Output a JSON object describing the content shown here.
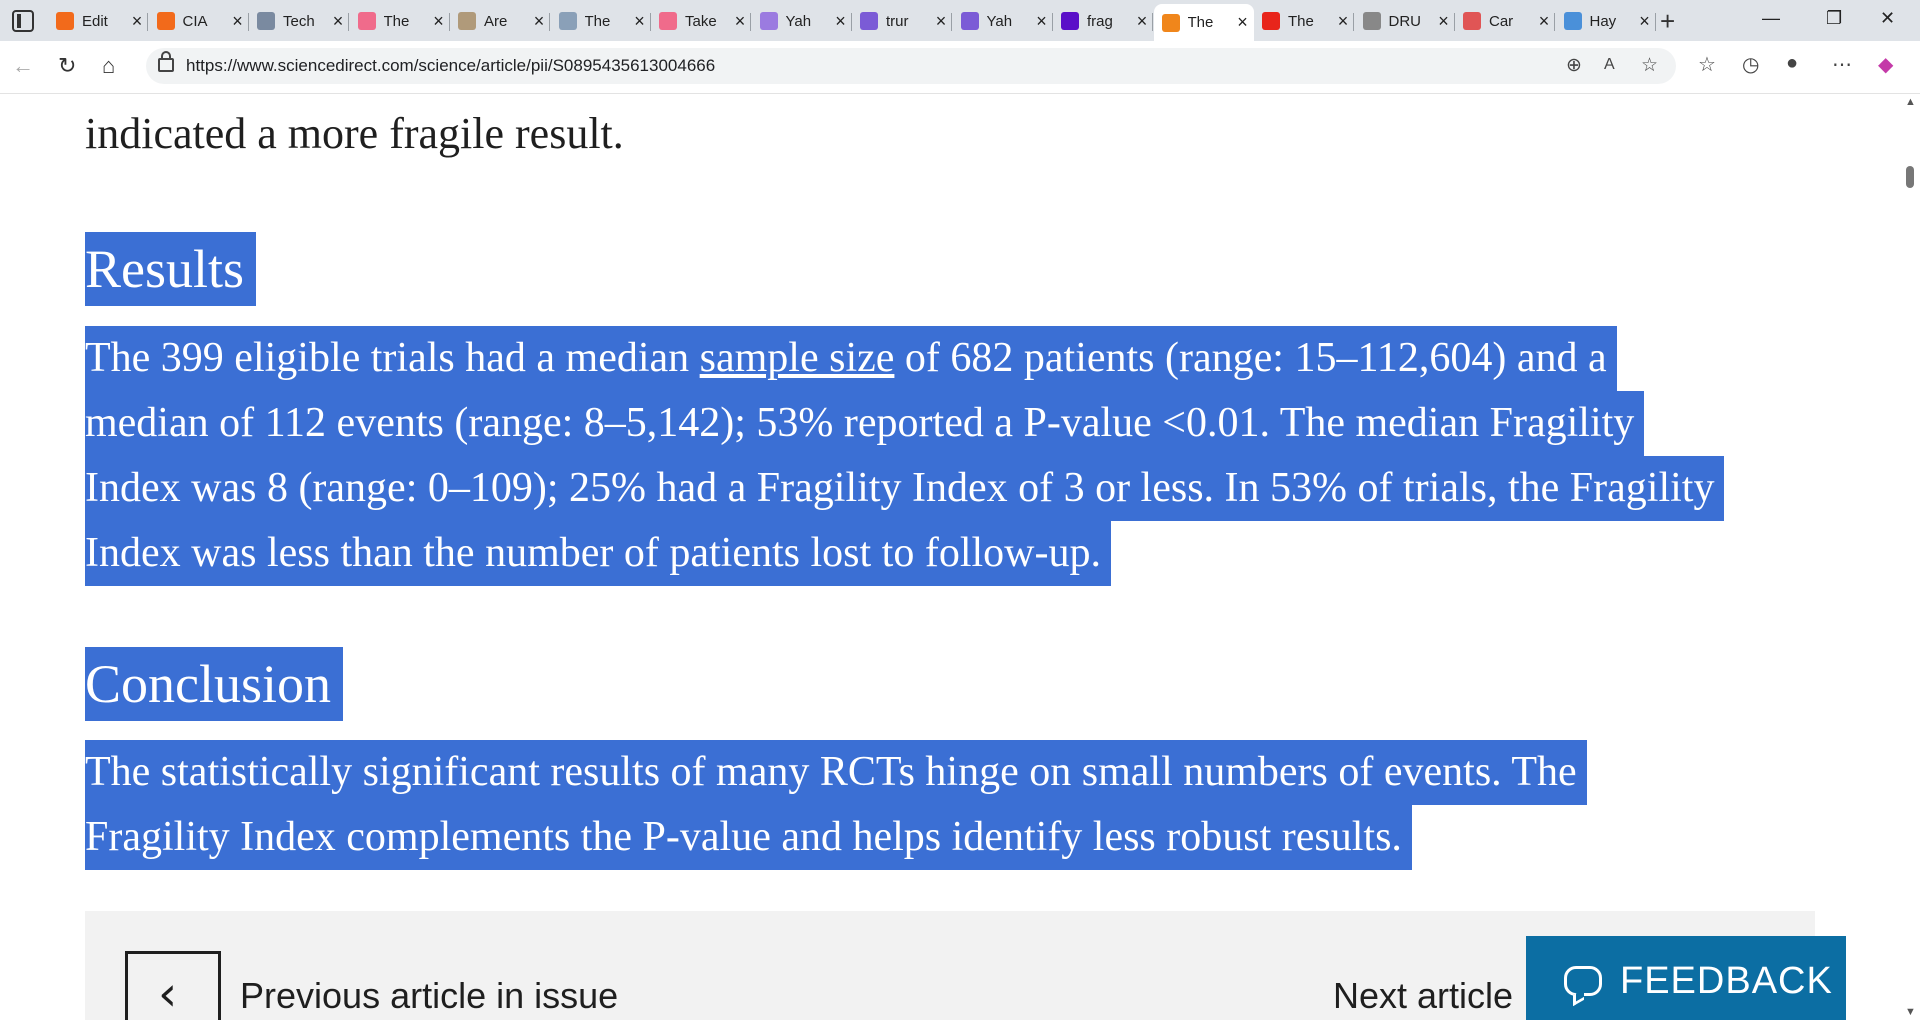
{
  "browser": {
    "tabs": [
      {
        "title": "Edit",
        "fav_color": "#f26a1b"
      },
      {
        "title": "CIA",
        "fav_color": "#f26a1b"
      },
      {
        "title": "Tech",
        "fav_color": "#7a8aa0"
      },
      {
        "title": "The",
        "fav_color": "#f06b8b"
      },
      {
        "title": "Are",
        "fav_color": "#b09a7a"
      },
      {
        "title": "The",
        "fav_color": "#8aa0b8"
      },
      {
        "title": "Take",
        "fav_color": "#f06b8b"
      },
      {
        "title": "Yah",
        "fav_color": "#9b7be0"
      },
      {
        "title": "trur",
        "fav_color": "#7b5bd6"
      },
      {
        "title": "Yah",
        "fav_color": "#7b5bd6"
      },
      {
        "title": "frag",
        "fav_color": "#5a0fc8"
      },
      {
        "title": "The",
        "fav_color": "#f0861b",
        "active": true
      },
      {
        "title": "The",
        "fav_color": "#e8251b"
      },
      {
        "title": "DRU",
        "fav_color": "#888888"
      },
      {
        "title": "Car",
        "fav_color": "#e05555"
      },
      {
        "title": "Hay",
        "fav_color": "#4a90d9"
      }
    ],
    "url": "https://www.sciencedirect.com/science/article/pii/S0895435613004666"
  },
  "article": {
    "previous_line": "indicated a more fragile result.",
    "results_heading": "Results",
    "results_lines": [
      [
        "The 399 eligible trials had a median ",
        "sample size",
        " of 682 patients (range: 15–112,604) and a"
      ],
      "median of 112 events (range: 8–5,142); 53% reported a P-value <0.01. The median Fragility",
      "Index was 8 (range: 0–109); 25% had a Fragility Index of 3 or less. In 53% of trials, the Fragility",
      "Index was less than the number of patients lost to follow-up."
    ],
    "conclusion_heading": "Conclusion",
    "conclusion_lines": [
      "The statistically significant results of many RCTs hinge on small numbers of events. The",
      "Fragility Index complements the P-value and helps identify less robust results."
    ]
  },
  "footer_nav": {
    "prev_label": "Previous article in issue",
    "next_label": "Next article"
  },
  "feedback_label": "FEEDBACK"
}
